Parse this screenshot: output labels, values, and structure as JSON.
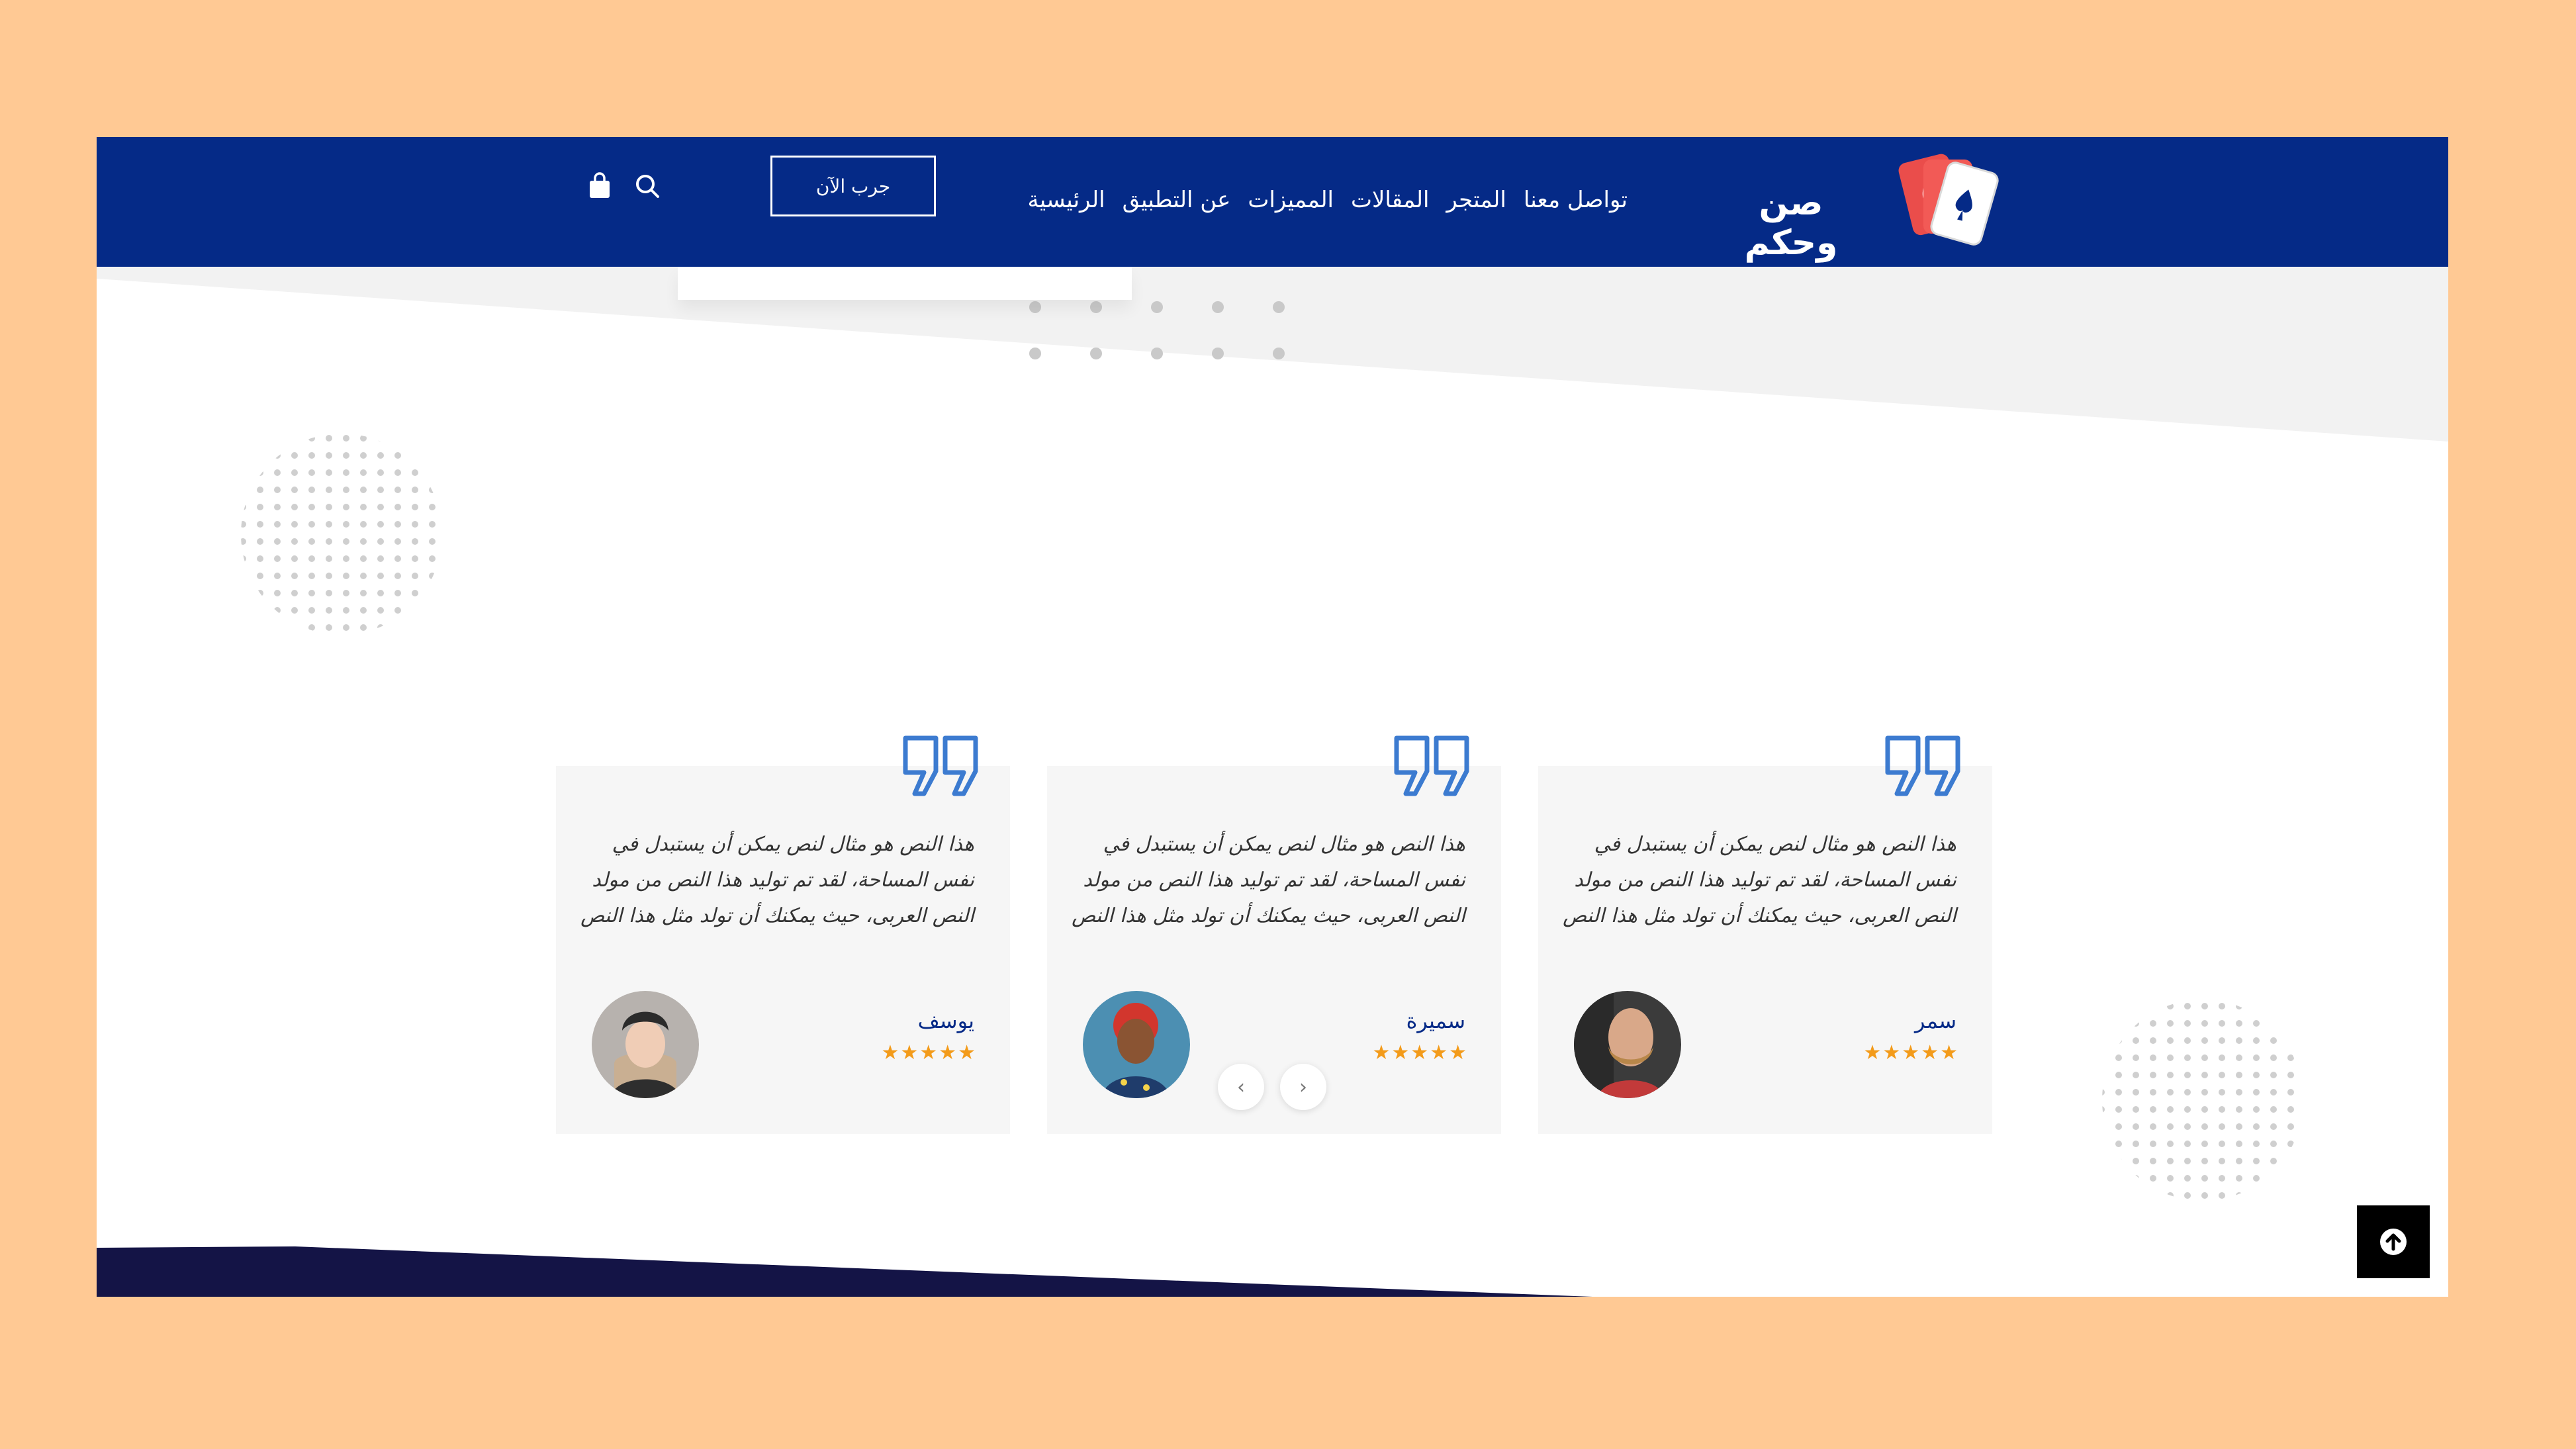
{
  "header": {
    "brand_name": "صن وحكم",
    "nav": [
      {
        "label": "الرئيسية"
      },
      {
        "label": "عن التطبيق"
      },
      {
        "label": "المميزات"
      },
      {
        "label": "المقالات"
      },
      {
        "label": "المتجر"
      },
      {
        "label": "تواصل معنا"
      }
    ],
    "cta_label": "جرب الآن",
    "icons": [
      "search-icon",
      "shopping-bag-icon"
    ]
  },
  "testimonials": [
    {
      "text": "هذا النص هو مثال لنص يمكن أن يستبدل في نفس المساحة، لقد تم توليد هذا النص من مولد النص العربى، حيث يمكنك أن تولد مثل هذا النص",
      "name": "سمر",
      "stars": "★★★★★",
      "rating": 5
    },
    {
      "text": "هذا النص هو مثال لنص يمكن أن يستبدل في نفس المساحة، لقد تم توليد هذا النص من مولد النص العربى، حيث يمكنك أن تولد مثل هذا النص",
      "name": "سميرة",
      "stars": "★★★★★",
      "rating": 5
    },
    {
      "text": "هذا النص هو مثال لنص يمكن أن يستبدل في نفس المساحة، لقد تم توليد هذا النص من مولد النص العربى، حيث يمكنك أن تولد مثل هذا النص",
      "name": "يوسف",
      "stars": "★★★★★",
      "rating": 5
    }
  ],
  "slider": {
    "prev": "‹",
    "next": "›"
  },
  "colors": {
    "background": "#FFC994",
    "header": "#052A87",
    "accent_blue": "#3C7BD0",
    "star": "#F39B1A",
    "card_bg": "#F6F6F6",
    "footer": "#141446"
  }
}
